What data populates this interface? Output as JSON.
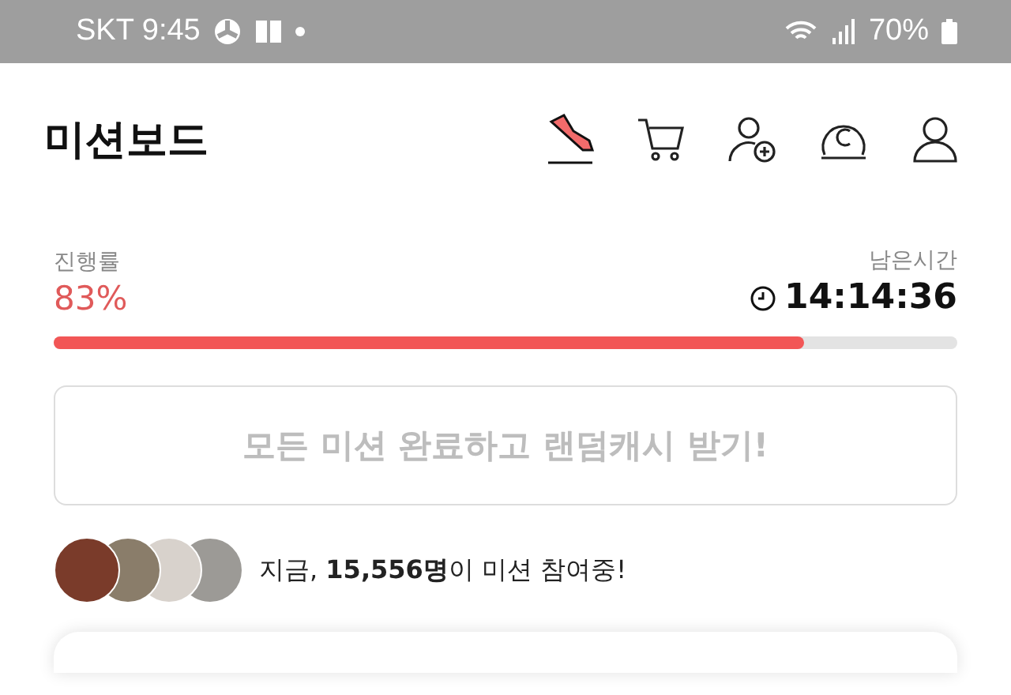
{
  "status_bar": {
    "carrier_time": "SKT 9:45",
    "battery": "70%"
  },
  "header": {
    "title": "미션보드"
  },
  "progress": {
    "label": "진행률",
    "value": "83%",
    "level": 0.83,
    "time_label": "남은시간",
    "time": "14:14:36"
  },
  "reward_button": {
    "label": "모든 미션 완료하고 랜덤캐시 받기!",
    "disabled": true
  },
  "participants": {
    "text": "지금, **15,556명**이 미션 참여중!"
  }
}
